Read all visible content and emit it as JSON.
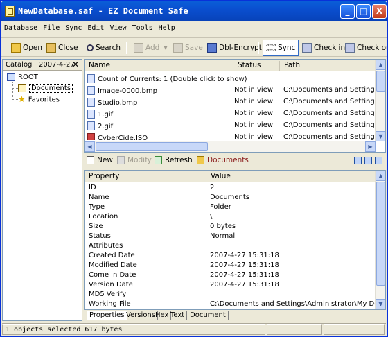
{
  "window": {
    "title": "NewDatabase.saf - EZ Document Safe",
    "minimize": "_",
    "maximize": "□",
    "close": "X"
  },
  "menu": [
    "Database",
    "File",
    "Sync",
    "Edit",
    "View",
    "Tools",
    "Help"
  ],
  "toolbar": {
    "open": "Open",
    "close": "Close",
    "search": "Search",
    "add": "Add",
    "save": "Save",
    "dbl_encrypt": "Dbl-Encrypt",
    "sync": "Sync",
    "check_in": "Check in",
    "check_out": "Check ou"
  },
  "catalog": {
    "label": "Catalog",
    "date": "2007-4-27",
    "close": "✕",
    "root": "ROOT",
    "documents": "Documents",
    "favorites": "Favorites"
  },
  "files": {
    "columns": [
      "Name",
      "Status",
      "Path"
    ],
    "rows": [
      {
        "name": "Count of Currents: 1 (Double click to show)",
        "status": "",
        "path": ""
      },
      {
        "name": "Image-0000.bmp",
        "status": "Not in view",
        "path": "C:\\Documents and Settings\\Adr"
      },
      {
        "name": "Studio.bmp",
        "status": "Not in view",
        "path": "C:\\Documents and Settings\\Adr"
      },
      {
        "name": "1.gif",
        "status": "Not in view",
        "path": "C:\\Documents and Settings\\Adr"
      },
      {
        "name": "2.gif",
        "status": "Not in view",
        "path": "C:\\Documents and Settings\\Adr"
      },
      {
        "name": "CyberCide.ISO",
        "status": "Not in view",
        "path": "C:\\Documents and Settings\\Adr"
      }
    ]
  },
  "props_toolbar": {
    "new": "New",
    "modify": "Modify",
    "refresh": "Refresh",
    "folder": "Documents"
  },
  "properties": {
    "columns": [
      "Property",
      "Value"
    ],
    "rows": [
      {
        "k": "ID",
        "v": "2"
      },
      {
        "k": "Name",
        "v": "Documents"
      },
      {
        "k": "Type",
        "v": "Folder"
      },
      {
        "k": "Location",
        "v": "\\"
      },
      {
        "k": "Size",
        "v": "0 bytes"
      },
      {
        "k": "Status",
        "v": "Normal"
      },
      {
        "k": "Attributes",
        "v": ""
      },
      {
        "k": "Created Date",
        "v": "2007-4-27 15:31:18"
      },
      {
        "k": "Modified Date",
        "v": "2007-4-27 15:31:18"
      },
      {
        "k": "Come in Date",
        "v": "2007-4-27 15:31:18"
      },
      {
        "k": "Version Date",
        "v": "2007-4-27 15:31:18"
      },
      {
        "k": "MD5 Verify",
        "v": ""
      },
      {
        "k": "Working File",
        "v": "C:\\Documents and Settings\\Administrator\\My Docum..."
      }
    ]
  },
  "tabs": [
    "Properties",
    "Versions",
    "Hex",
    "Text",
    "Document"
  ],
  "status": {
    "text": "1 objects selected 617 bytes"
  }
}
